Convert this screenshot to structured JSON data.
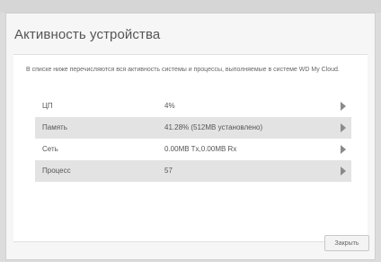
{
  "dialog": {
    "title": "Активность устройства",
    "description": "В списке ниже перечисляются вся активность системы и процессы, выполняемые в системе WD My Cloud.",
    "rows": [
      {
        "label": "ЦП",
        "value": "4%"
      },
      {
        "label": "Память",
        "value": "41.28% (512MB установлено)"
      },
      {
        "label": "Сеть",
        "value": "0.00MB Tx,0.00MB Rx"
      },
      {
        "label": "Процесс",
        "value": "57"
      }
    ],
    "close_label": "Закрыть"
  }
}
